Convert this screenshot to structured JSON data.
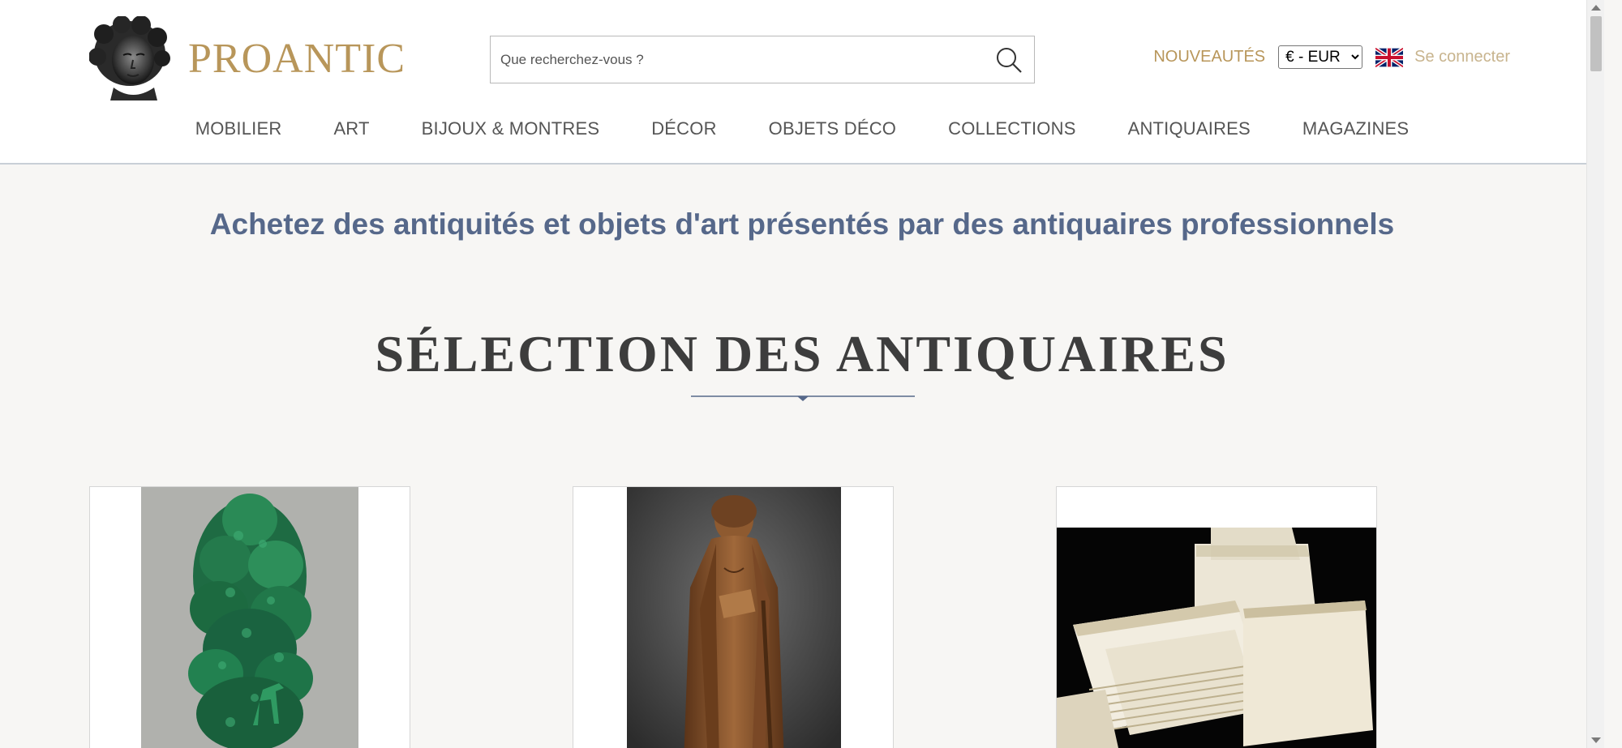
{
  "header": {
    "logo_text": "PROANTIC",
    "search_placeholder": "Que recherchez-vous ?",
    "nouveautes": "NOUVEAUTÉS",
    "currency_selected": "€ - EUR",
    "language_flag": "uk-flag-icon",
    "login": "Se connecter"
  },
  "nav": {
    "items": [
      "MOBILIER",
      "ART",
      "BIJOUX & MONTRES",
      "DÉCOR",
      "OBJETS DÉCO",
      "COLLECTIONS",
      "ANTIQUAIRES",
      "MAGAZINES"
    ]
  },
  "main": {
    "tagline": "Achetez des antiquités et objets d'art présentés par des antiquaires professionnels",
    "section_title": "SÉLECTION DES ANTIQUAIRES"
  },
  "colors": {
    "accent_gold": "#b8965a",
    "tagline_blue": "#56688a",
    "background": "#f7f6f4"
  },
  "icons": {
    "search": "search-icon",
    "logo": "bust-logo-icon"
  }
}
